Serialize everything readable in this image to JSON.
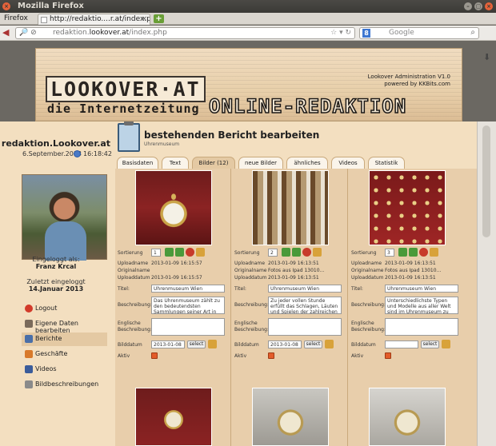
{
  "window": {
    "title": "Mozilla Firefox"
  },
  "browser": {
    "menu_label": "Firefox",
    "tab_title": "http://redaktio....r.at/index.php",
    "url_prefix": "redaktion.",
    "url_domain": "lookover.at",
    "url_path": "/index.php",
    "search_placeholder": "Google"
  },
  "header": {
    "logo_line1": "LOOKOVER·AT",
    "logo_line2": "die Internetzeitung",
    "logo_line3": "ONLINE-REDAKTION",
    "admin_title": "Lookover Administration V1.0",
    "admin_powered": "powered by KKBits.com"
  },
  "sidebar": {
    "site": "redaktion.Lookover.at",
    "date": "6.September.2013",
    "time": "16:18:42",
    "logged_label": "Eingeloggt als:",
    "user": "Franz Krcal",
    "last_label": "Zuletzt eingeloggt",
    "last_date": "14.Januar 2013",
    "menu": [
      {
        "label": "Logout",
        "color": "#d23a2a"
      },
      {
        "label": "Eigene Daten bearbeiten",
        "color": "#7a6a5a"
      },
      {
        "label": "Berichte",
        "color": "#4a6fa8"
      },
      {
        "label": "Geschäfte",
        "color": "#d8792a"
      },
      {
        "label": "Videos",
        "color": "#3b5c9a"
      },
      {
        "label": "Bildbeschreibungen",
        "color": "#8a8a8a"
      }
    ]
  },
  "main": {
    "title": "bestehenden Bericht bearbeiten",
    "subtitle": "Uhrenmuseum",
    "tabs": [
      "Basisdaten",
      "Text",
      "Bilder (12)",
      "neue Bilder",
      "ähnliches",
      "Videos",
      "Statistik"
    ],
    "labels": {
      "sort": "Sortierung",
      "upload_name": "Uploadname",
      "upload_date": "Uploaddatum",
      "orig_name": "Originalname",
      "title": "Titel:",
      "desc": "Beschreibung:",
      "eng_desc": "Englische Beschreibung:",
      "image_date": "Bilddatum",
      "active": "Aktiv",
      "select": "select"
    },
    "images": [
      {
        "sort": "1",
        "upload_name": "2013-01-09 16:15:57",
        "orig_name": "",
        "upload_date": "2013-01-09 16:15:57",
        "title": "Uhrenmuseum Wien",
        "desc": "Das Uhrenmuseum zählt zu den bedeutendsten Sammlungen seiner Art in ganz",
        "image_date": "2013-01-08"
      },
      {
        "sort": "2",
        "upload_name": "2013-01-09 16:13:51",
        "orig_name": "Fotos aus Ipad 13010...",
        "upload_date": "2013-01-09 16:13:51",
        "title": "Uhrenmuseum Wien",
        "desc": "Zu jeder vollen Stunde erfüllt das Schlagen, Läuten und Spielen der zahlreichen Ju",
        "image_date": "2013-01-08"
      },
      {
        "sort": "3",
        "upload_name": "2013-01-09 16:13:51",
        "orig_name": "Fotos aus Ipad 13010...",
        "upload_date": "2013-01-09 16:13:51",
        "title": "Uhrenmuseum Wien",
        "desc": "Unterschiedlichste Typen und Modelle aus aller Welt sind im Uhrenmuseum zu sehen:",
        "image_date": ""
      }
    ]
  }
}
